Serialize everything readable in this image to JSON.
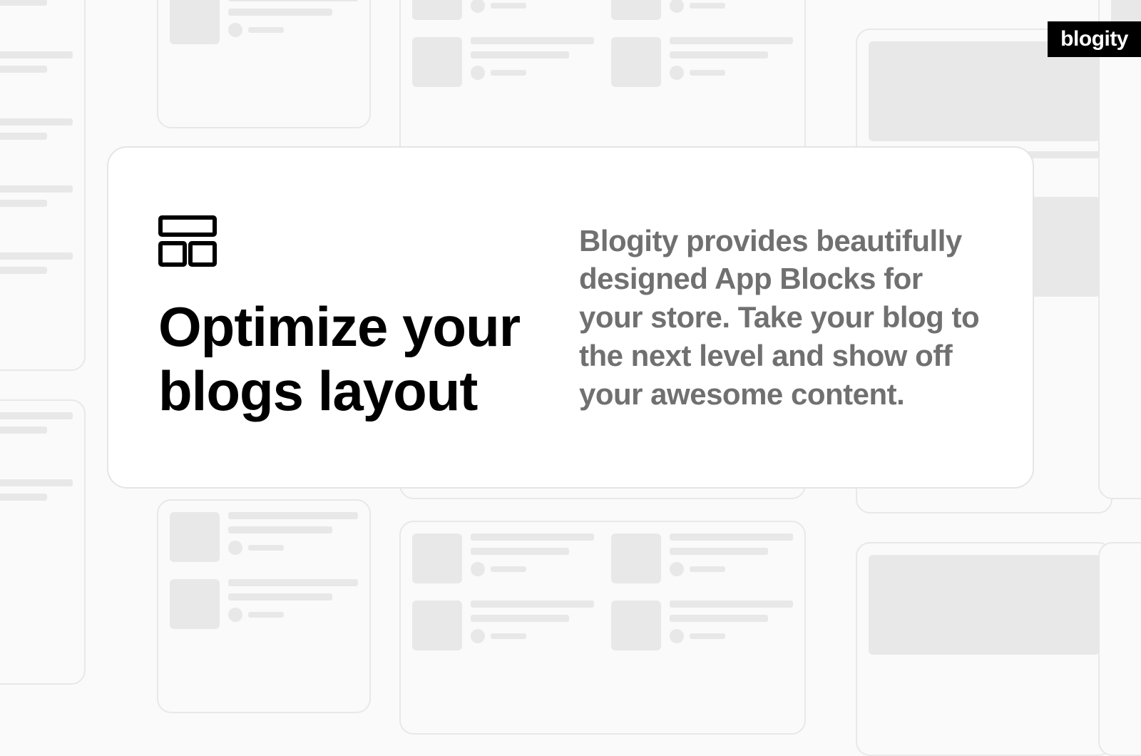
{
  "brand": "blogity",
  "hero": {
    "title": "Optimize your blogs layout",
    "description": "Blogity provides beautifully designed App Blocks for your store. Take your blog to the next level and show off your awesome content."
  }
}
